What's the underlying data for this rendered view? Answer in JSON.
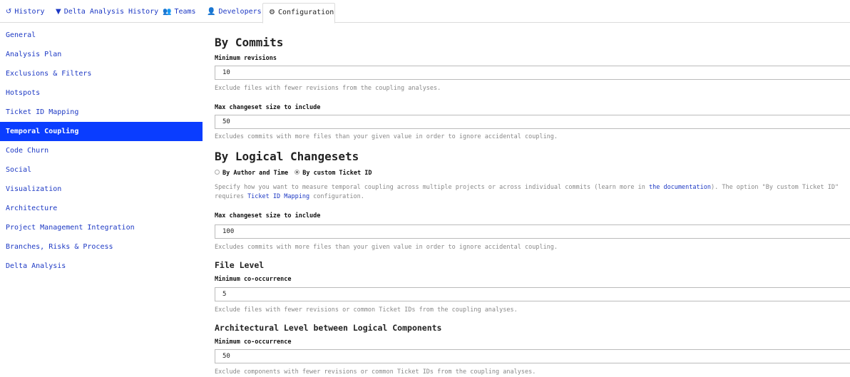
{
  "tabs": [
    {
      "icon": "history-icon",
      "glyph": "↺",
      "label": "History"
    },
    {
      "icon": "filter-icon",
      "glyph": "▼",
      "label": "Delta Analysis History"
    },
    {
      "icon": "users-icon",
      "glyph": "👥",
      "label": "Teams"
    },
    {
      "icon": "user-icon",
      "glyph": "👤",
      "label": "Developers"
    },
    {
      "icon": "gears-icon",
      "glyph": "⚙",
      "label": "Configuration"
    }
  ],
  "sidebar": {
    "items": [
      "General",
      "Analysis Plan",
      "Exclusions & Filters",
      "Hotspots",
      "Ticket ID Mapping",
      "Temporal Coupling",
      "Code Churn",
      "Social",
      "Visualization",
      "Architecture",
      "Project Management Integration",
      "Branches, Risks & Process",
      "Delta Analysis"
    ],
    "active_index": 5
  },
  "by_commits": {
    "heading": "By Commits",
    "min_revisions": {
      "label": "Minimum revisions",
      "value": "10",
      "help": "Exclude files with fewer revisions from the coupling analyses."
    },
    "max_changeset": {
      "label": "Max changeset size to include",
      "value": "50",
      "help": "Excludes commits with more files than your given value in order to ignore accidental coupling."
    }
  },
  "by_logical": {
    "heading": "By Logical Changesets",
    "radio_author_time": "By Author and Time",
    "radio_custom_ticket": "By custom Ticket ID",
    "selected": "custom_ticket",
    "desc_part1": "Specify how you want to measure temporal coupling across multiple projects or across individual commits (learn more in ",
    "desc_link1": "the documentation",
    "desc_part2": "). The option \"By custom Ticket ID\" requires ",
    "desc_link2": "Ticket ID Mapping",
    "desc_part3": " configuration.",
    "max_changeset": {
      "label": "Max changeset size to include",
      "value": "100",
      "help": "Excludes commits with more files than your given value in order to ignore accidental coupling."
    }
  },
  "file_level": {
    "heading": "File Level",
    "label": "Minimum co-occurrence",
    "value": "5",
    "help": "Exclude files with fewer revisions or common Ticket IDs from the coupling analyses."
  },
  "arch_level": {
    "heading": "Architectural Level between Logical Components",
    "label": "Minimum co-occurrence",
    "value": "50",
    "help": "Exclude components with fewer revisions or common Ticket IDs from the coupling analyses."
  }
}
